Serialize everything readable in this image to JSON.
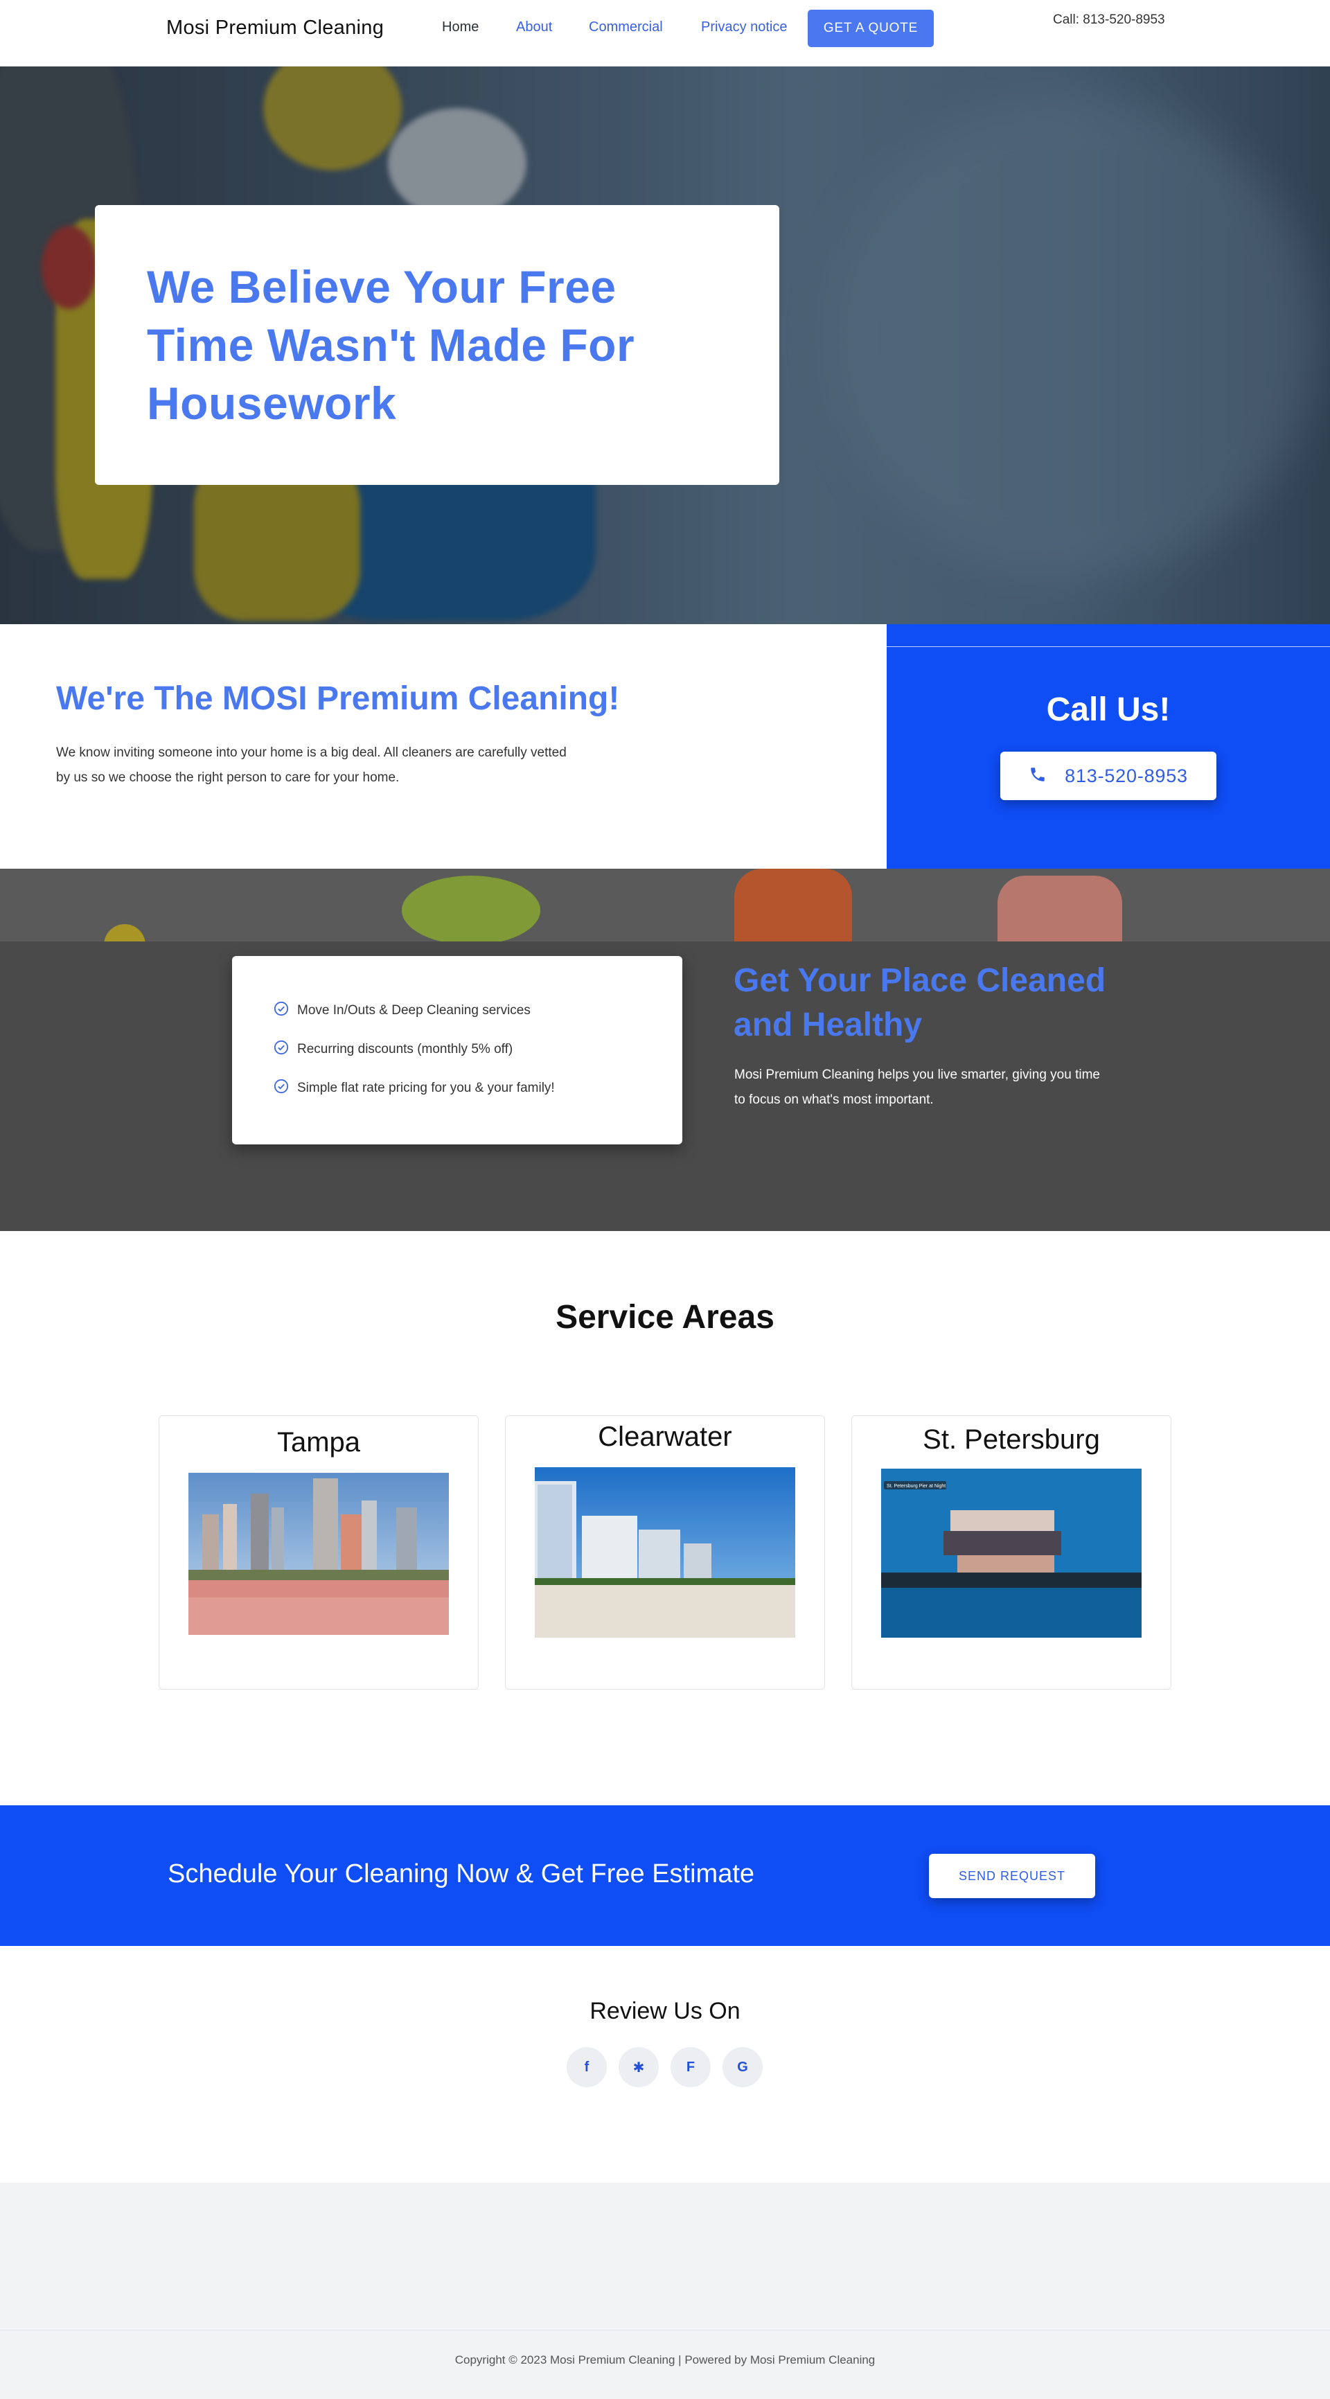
{
  "header": {
    "logo": "Mosi Premium Cleaning",
    "nav": [
      {
        "label": "Home"
      },
      {
        "label": "About"
      },
      {
        "label": "Commercial"
      },
      {
        "label": "Privacy notice"
      }
    ],
    "quote_button": "GET A QUOTE",
    "phone": "Call: 813-520-8953"
  },
  "hero": {
    "title": "We Believe Your Free Time Wasn't Made For Housework"
  },
  "about": {
    "title": "We're The MOSI Premium Cleaning!",
    "text": "We know inviting someone into your home is a big deal. All  cleaners are carefully vetted by us so we choose the right person to care for your home."
  },
  "call": {
    "title": "Call Us!",
    "phone_button": "813-520-8953",
    "icon": "phone-icon"
  },
  "features": {
    "items": [
      {
        "label": "Move In/Outs & Deep Cleaning services"
      },
      {
        "label": "Recurring discounts (monthly 5% off)"
      },
      {
        "label": "Simple flat rate pricing for you & your family!"
      }
    ],
    "title": "Get Your Place Cleaned and Healthy",
    "text": "Mosi Premium Cleaning helps you live smarter, giving you time to focus on what's most important."
  },
  "areas": {
    "title": "Service Areas",
    "cities": [
      {
        "name": "Tampa"
      },
      {
        "name": "Clearwater"
      },
      {
        "name": "St. Petersburg"
      }
    ],
    "stpete_caption": "St. Petersburg Pier at Night"
  },
  "schedule": {
    "text": "Schedule Your Cleaning Now & Get Free Estimate",
    "button": "SEND REQUEST"
  },
  "review": {
    "title": "Review Us On",
    "icons": [
      {
        "name": "facebook-icon",
        "glyph": "f"
      },
      {
        "name": "yelp-icon",
        "glyph": "✱"
      },
      {
        "name": "foursquare-icon",
        "glyph": "F"
      },
      {
        "name": "google-icon",
        "glyph": "G"
      }
    ]
  },
  "footer": {
    "copyright": "Copyright © 2023 Mosi Premium Cleaning | Powered by Mosi Premium Cleaning"
  },
  "colors": {
    "accent": "#4a78ee",
    "brand_blue": "#0f4df5",
    "dark_band": "#4a4a4a"
  }
}
